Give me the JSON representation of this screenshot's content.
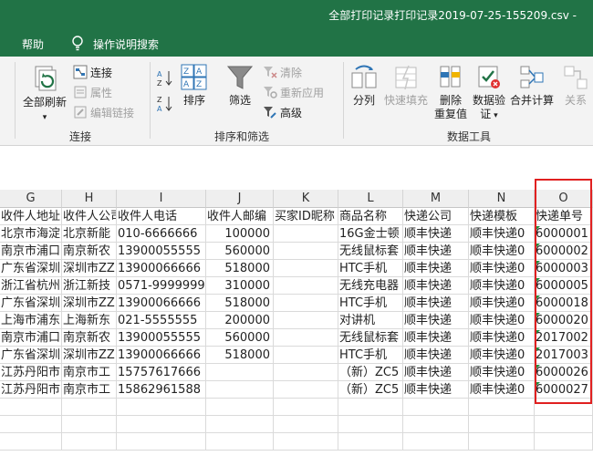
{
  "window": {
    "title": "全部打印记录打印记录2019-07-25-155209.csv - "
  },
  "tabs": {
    "help": "帮助",
    "tell_me": "操作说明搜索"
  },
  "ribbon": {
    "connections": {
      "refresh_all": "全部刷新",
      "connections": "连接",
      "properties": "属性",
      "edit_links": "编辑链接",
      "label": "连接"
    },
    "sort_filter": {
      "sort": "排序",
      "filter": "筛选",
      "clear": "清除",
      "reapply": "重新应用",
      "advanced": "高级",
      "label": "排序和筛选"
    },
    "data_tools": {
      "text_to_columns": "分列",
      "flash_fill": "快速填充",
      "remove_duplicates_1": "删除",
      "remove_duplicates_2": "重复值",
      "data_validation_1": "数据验",
      "data_validation_2": "证",
      "consolidate": "合并计算",
      "relationships": "关系",
      "label": "数据工具"
    }
  },
  "grid": {
    "columns": [
      "G",
      "H",
      "I",
      "J",
      "K",
      "L",
      "M",
      "N",
      "O"
    ],
    "headers": [
      "收件人地址",
      "收件人公司",
      "收件人电话",
      "收件人邮编",
      "买家ID昵称",
      "商品名称",
      "快递公司",
      "快递模板",
      "快递单号"
    ],
    "rows": [
      [
        "北京市海淀区",
        "北京新能",
        "010-6666666",
        "100000",
        "",
        "16G金士顿",
        "顺丰快递",
        "顺丰快递0",
        "6000001"
      ],
      [
        "南京市浦口",
        "南京新农",
        "13900055555",
        "560000",
        "",
        "无线鼠标套",
        "顺丰快递",
        "顺丰快递0",
        "6000002"
      ],
      [
        "广东省深圳",
        "深圳市ZZ",
        "13900066666",
        "518000",
        "",
        "HTC手机",
        "顺丰快递",
        "顺丰快递0",
        "6000003"
      ],
      [
        "浙江省杭州",
        "浙江新技",
        "0571-9999999",
        "310000",
        "",
        "无线充电器",
        "顺丰快递",
        "顺丰快递0",
        "6000005"
      ],
      [
        "广东省深圳",
        "深圳市ZZ",
        "13900066666",
        "518000",
        "",
        "HTC手机",
        "顺丰快递",
        "顺丰快递0",
        "6000018"
      ],
      [
        "上海市浦东",
        "上海新东",
        "021-5555555",
        "200000",
        "",
        "对讲机",
        "顺丰快递",
        "顺丰快递0",
        "6000020"
      ],
      [
        "南京市浦口",
        "南京新农",
        "13900055555",
        "560000",
        "",
        "无线鼠标套",
        "顺丰快递",
        "顺丰快递0",
        "2017002"
      ],
      [
        "广东省深圳",
        "深圳市ZZ",
        "13900066666",
        "518000",
        "",
        "HTC手机",
        "顺丰快递",
        "顺丰快递0",
        "2017003"
      ],
      [
        "江苏丹阳市",
        "南京市工",
        "15757617666",
        "",
        "",
        "（新）ZC5",
        "顺丰快递",
        "顺丰快递0",
        "6000026"
      ],
      [
        "江苏丹阳市",
        "南京市工",
        "15862961588",
        "",
        "",
        "（新）ZC5",
        "顺丰快递",
        "顺丰快递0",
        "6000027"
      ]
    ]
  },
  "colors": {
    "accent": "#217346",
    "highlight": "#e02020"
  }
}
